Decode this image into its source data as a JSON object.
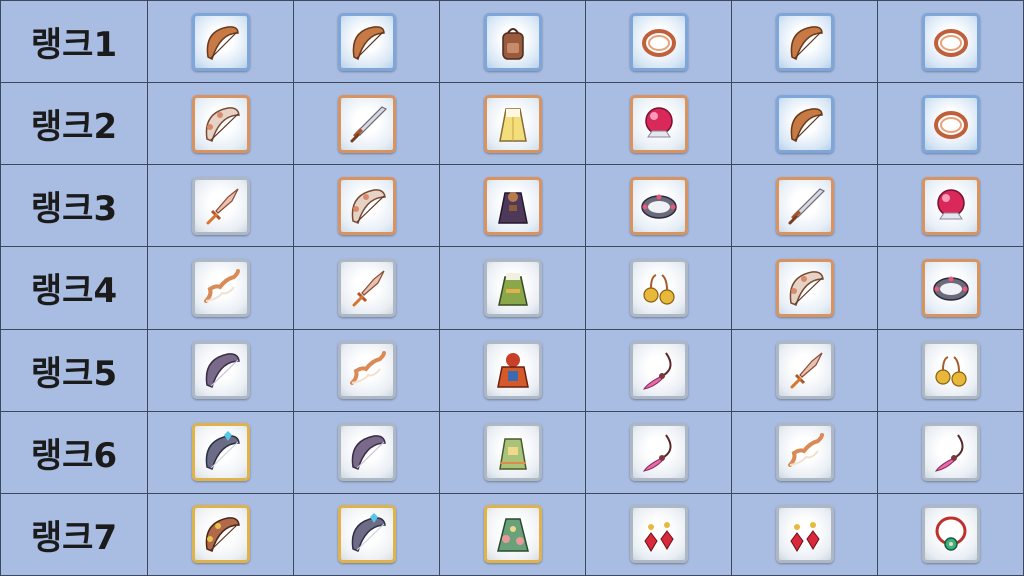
{
  "ranks": [
    {
      "label": "랭크1",
      "items": [
        {
          "icon": "bow-icon",
          "frame": "blue"
        },
        {
          "icon": "bow-icon",
          "frame": "blue"
        },
        {
          "icon": "backpack-icon",
          "frame": "blue"
        },
        {
          "icon": "bracelet-icon",
          "frame": "blue"
        },
        {
          "icon": "bow-icon",
          "frame": "blue"
        },
        {
          "icon": "bracelet-icon",
          "frame": "blue"
        }
      ]
    },
    {
      "label": "랭크2",
      "items": [
        {
          "icon": "ornate-bow-icon",
          "frame": "copper"
        },
        {
          "icon": "sword-icon",
          "frame": "copper"
        },
        {
          "icon": "robe-icon",
          "frame": "copper"
        },
        {
          "icon": "crystal-orb-icon",
          "frame": "copper"
        },
        {
          "icon": "bow-icon",
          "frame": "blue"
        },
        {
          "icon": "bracelet-icon",
          "frame": "blue"
        }
      ]
    },
    {
      "label": "랭크3",
      "items": [
        {
          "icon": "dagger-icon",
          "frame": "silver"
        },
        {
          "icon": "ornate-bow-icon",
          "frame": "copper"
        },
        {
          "icon": "dark-robe-icon",
          "frame": "copper"
        },
        {
          "icon": "jeweled-bangle-icon",
          "frame": "copper"
        },
        {
          "icon": "sword-icon",
          "frame": "copper"
        },
        {
          "icon": "crystal-orb-icon",
          "frame": "copper"
        }
      ]
    },
    {
      "label": "랭크4",
      "items": [
        {
          "icon": "recurve-bow-icon",
          "frame": "silver"
        },
        {
          "icon": "dagger-icon",
          "frame": "silver"
        },
        {
          "icon": "green-robe-icon",
          "frame": "silver"
        },
        {
          "icon": "gold-earrings-icon",
          "frame": "silver"
        },
        {
          "icon": "ornate-bow-icon",
          "frame": "copper"
        },
        {
          "icon": "jeweled-bangle-icon",
          "frame": "copper"
        }
      ]
    },
    {
      "label": "랭크5",
      "items": [
        {
          "icon": "dark-bow-icon",
          "frame": "silver"
        },
        {
          "icon": "recurve-bow-icon",
          "frame": "silver"
        },
        {
          "icon": "red-armor-icon",
          "frame": "silver"
        },
        {
          "icon": "feather-pendant-icon",
          "frame": "silver"
        },
        {
          "icon": "dagger-icon",
          "frame": "silver"
        },
        {
          "icon": "gold-earrings-icon",
          "frame": "silver"
        }
      ]
    },
    {
      "label": "랭크6",
      "items": [
        {
          "icon": "crystal-bow-icon",
          "frame": "gold"
        },
        {
          "icon": "dark-bow-icon",
          "frame": "silver"
        },
        {
          "icon": "green-armor-icon",
          "frame": "silver"
        },
        {
          "icon": "feather-pendant-icon",
          "frame": "silver"
        },
        {
          "icon": "recurve-bow-icon",
          "frame": "silver"
        },
        {
          "icon": "feather-pendant-icon",
          "frame": "silver"
        }
      ]
    },
    {
      "label": "랭크7",
      "items": [
        {
          "icon": "royal-bow-icon",
          "frame": "gold"
        },
        {
          "icon": "crystal-bow-icon",
          "frame": "gold"
        },
        {
          "icon": "floral-dress-icon",
          "frame": "gold"
        },
        {
          "icon": "gem-earrings-icon",
          "frame": "silver"
        },
        {
          "icon": "gem-earrings-icon",
          "frame": "silver"
        },
        {
          "icon": "jade-necklace-icon",
          "frame": "silver"
        }
      ]
    }
  ],
  "colors": {
    "background": "#a9bde3",
    "grid_line": "#3c4760",
    "frame_blue": "#7fa6d9",
    "frame_copper": "#d9935e",
    "frame_silver": "#aeb7c4",
    "frame_gold": "#e0b24a"
  }
}
